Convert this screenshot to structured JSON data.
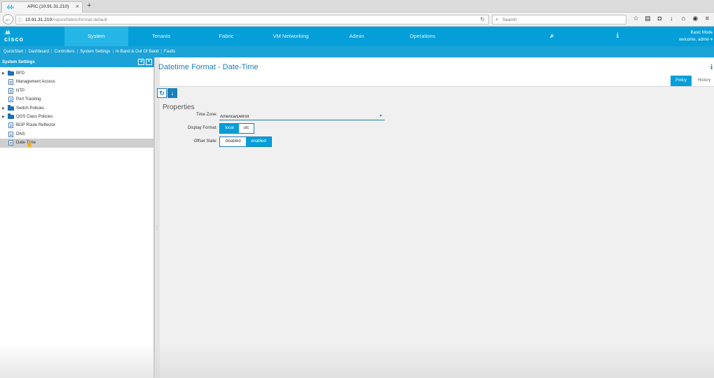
{
  "browser": {
    "tab_title": "APIC (10.91.31.210)",
    "url_host": "10.91.31.219",
    "url_path": "/#a|uni/fabric/format-default",
    "search_placeholder": "Search"
  },
  "apic": {
    "logo_text": "cisco",
    "nav": [
      "System",
      "Tenants",
      "Fabric",
      "VM Networking",
      "Admin",
      "Operations"
    ],
    "active_nav": "System",
    "mode": "Basic Mode",
    "welcome": "welcome, admin ▾",
    "subnav": [
      "QuickStart",
      "Dashboard",
      "Controllers",
      "System Settings",
      "In Band & Out Of Band",
      "Faults"
    ]
  },
  "sidebar": {
    "title": "System Settings",
    "items": [
      {
        "label": "BFD",
        "type": "folder"
      },
      {
        "label": "Management Access",
        "type": "doc"
      },
      {
        "label": "NTP",
        "type": "doc"
      },
      {
        "label": "Port Tracking",
        "type": "doc"
      },
      {
        "label": "Switch Policies",
        "type": "folder"
      },
      {
        "label": "QOS Class Policies",
        "type": "folder"
      },
      {
        "label": "BGP Route Reflector",
        "type": "doc"
      },
      {
        "label": "DNS",
        "type": "doc"
      },
      {
        "label": "Date-Time",
        "type": "doc",
        "selected": true
      }
    ]
  },
  "main": {
    "title": "Datetime Format - Date-Time",
    "tabs": [
      "Policy",
      "History"
    ],
    "active_tab": "Policy",
    "properties_heading": "Properties",
    "time_zone_label": "Time Zone:",
    "time_zone_value": "America/Detroit",
    "display_format_label": "Display Format:",
    "display_format_options": [
      "local",
      "utc"
    ],
    "display_format_selected": "local",
    "offset_state_label": "Offset State:",
    "offset_state_options": [
      "disabled",
      "enabled"
    ],
    "offset_state_selected": "enabled"
  },
  "colors": {
    "accent": "#049fd9",
    "accent_dark": "#1c7fb8",
    "nav_active": "#25b5e6"
  }
}
